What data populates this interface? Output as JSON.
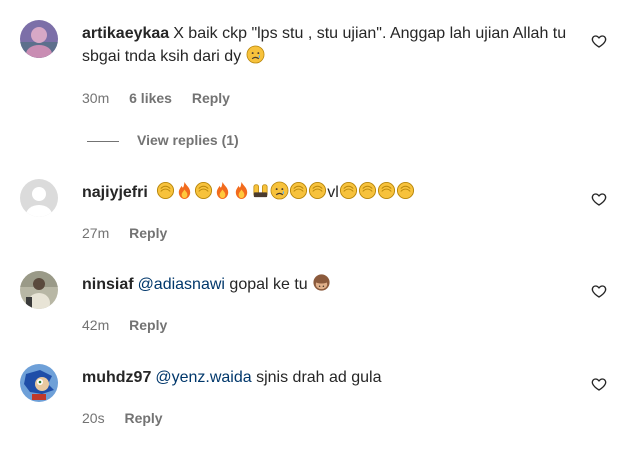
{
  "comments": [
    {
      "username": "artikaeykaa",
      "text": "X baik ckp \"lps stu , stu ujian\". Anggap lah ujian Allah tu sbgai tnda ksih dari dy",
      "time": "30m",
      "likes": "6 likes",
      "reply": "Reply",
      "view_replies": "View replies (1)"
    },
    {
      "username": "najiyjefri",
      "text_after": "vl",
      "time": "27m",
      "reply": "Reply"
    },
    {
      "username": "ninsiaf",
      "mention": "@adiasnawi",
      "text": "gopal ke tu",
      "time": "42m",
      "reply": "Reply"
    },
    {
      "username": "muhdz97",
      "mention": "@yenz.waida",
      "text": "sjnis drah ad gula",
      "time": "20s",
      "reply": "Reply"
    }
  ],
  "icons": {
    "like": "heart-outline-icon",
    "emoji_sad": "crying-face-icon",
    "emoji_clap": "clapping-hands-icon",
    "emoji_fire": "fire-icon",
    "emoji_raise": "raising-hands-icon",
    "emoji_monkey": "see-no-evil-monkey-icon"
  }
}
